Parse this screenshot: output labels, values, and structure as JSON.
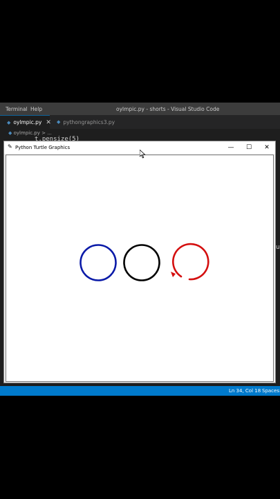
{
  "menubar": {
    "items": [
      "Terminal",
      "Help"
    ],
    "title": "oylmpic.py - shorts - Visual Studio Code"
  },
  "tabs": [
    {
      "label": "oylmpic.py",
      "active": true,
      "icon": "python-file-icon"
    },
    {
      "label": "pythongraphics3.py",
      "active": false,
      "icon": "python-file-icon"
    }
  ],
  "breadcrumb": {
    "file": "oylmpic.py",
    "separator": ">",
    "rest": "..."
  },
  "code_peek": "t.pensize(5)",
  "turtle_window": {
    "title": "Python Turtle Graphics",
    "buttons": {
      "minimize": "—",
      "maximize": "☐",
      "close": "✕"
    },
    "circles": [
      {
        "color": "#0a1aa8",
        "complete": true
      },
      {
        "color": "#000000",
        "complete": true
      },
      {
        "color": "#d40f0f",
        "complete": false
      }
    ]
  },
  "statusbar": {
    "position": "Ln 34, Col 18",
    "spaces": "Spaces:"
  },
  "side_glyph": "u",
  "colors": {
    "status": "#007acc",
    "editor_bg": "#1e1e1e",
    "menubar": "#3c3c3c"
  }
}
